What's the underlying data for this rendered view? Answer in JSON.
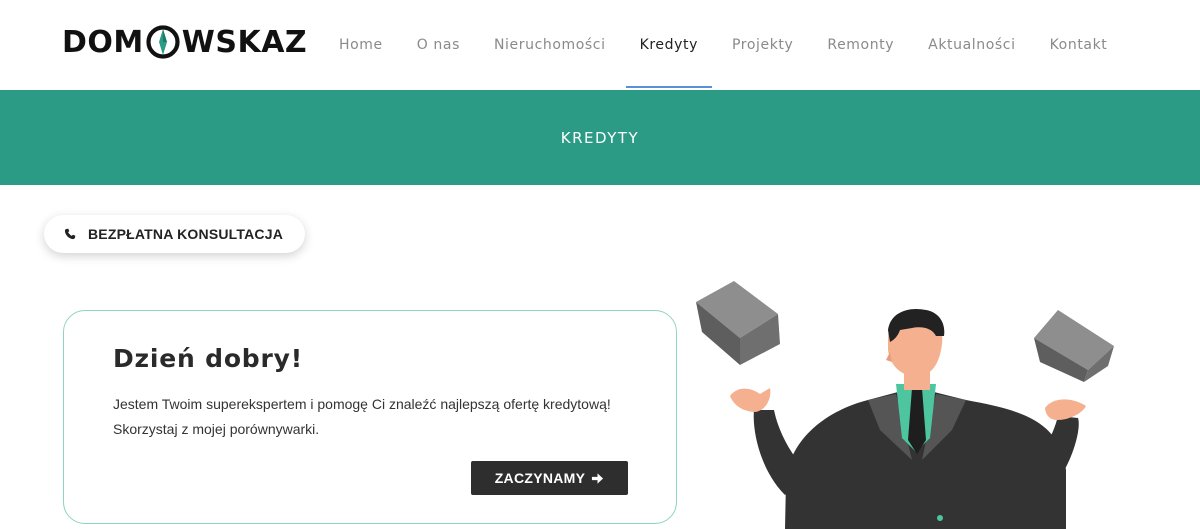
{
  "header": {
    "logo": {
      "text_before": "DOM",
      "text_after": "WSKAZ",
      "icon": "compass-icon"
    },
    "nav": [
      {
        "label": "Home",
        "active": false
      },
      {
        "label": "O nas",
        "active": false
      },
      {
        "label": "Nieruchomości",
        "active": false
      },
      {
        "label": "Kredyty",
        "active": true
      },
      {
        "label": "Projekty",
        "active": false
      },
      {
        "label": "Remonty",
        "active": false
      },
      {
        "label": "Aktualności",
        "active": false
      },
      {
        "label": "Kontakt",
        "active": false
      }
    ]
  },
  "banner": {
    "title": "KREDYTY"
  },
  "consult": {
    "label": "BEZPŁATNA KONSULTACJA",
    "icon": "phone-icon"
  },
  "card": {
    "title": "Dzień dobry!",
    "line1": "Jestem Twoim superekspertem i pomogę Ci znaleźć najlepszą ofertę kredytową!",
    "line2": "Skorzystaj z mojej porównywarki.",
    "button_label": "ZACZYNAMY",
    "button_icon": "arrow-right-icon"
  },
  "colors": {
    "accent": "#2b9b86",
    "nav_active_underline": "#5b8fd9",
    "button_dark": "#2e2e2e",
    "card_border": "#8fd3c4"
  }
}
